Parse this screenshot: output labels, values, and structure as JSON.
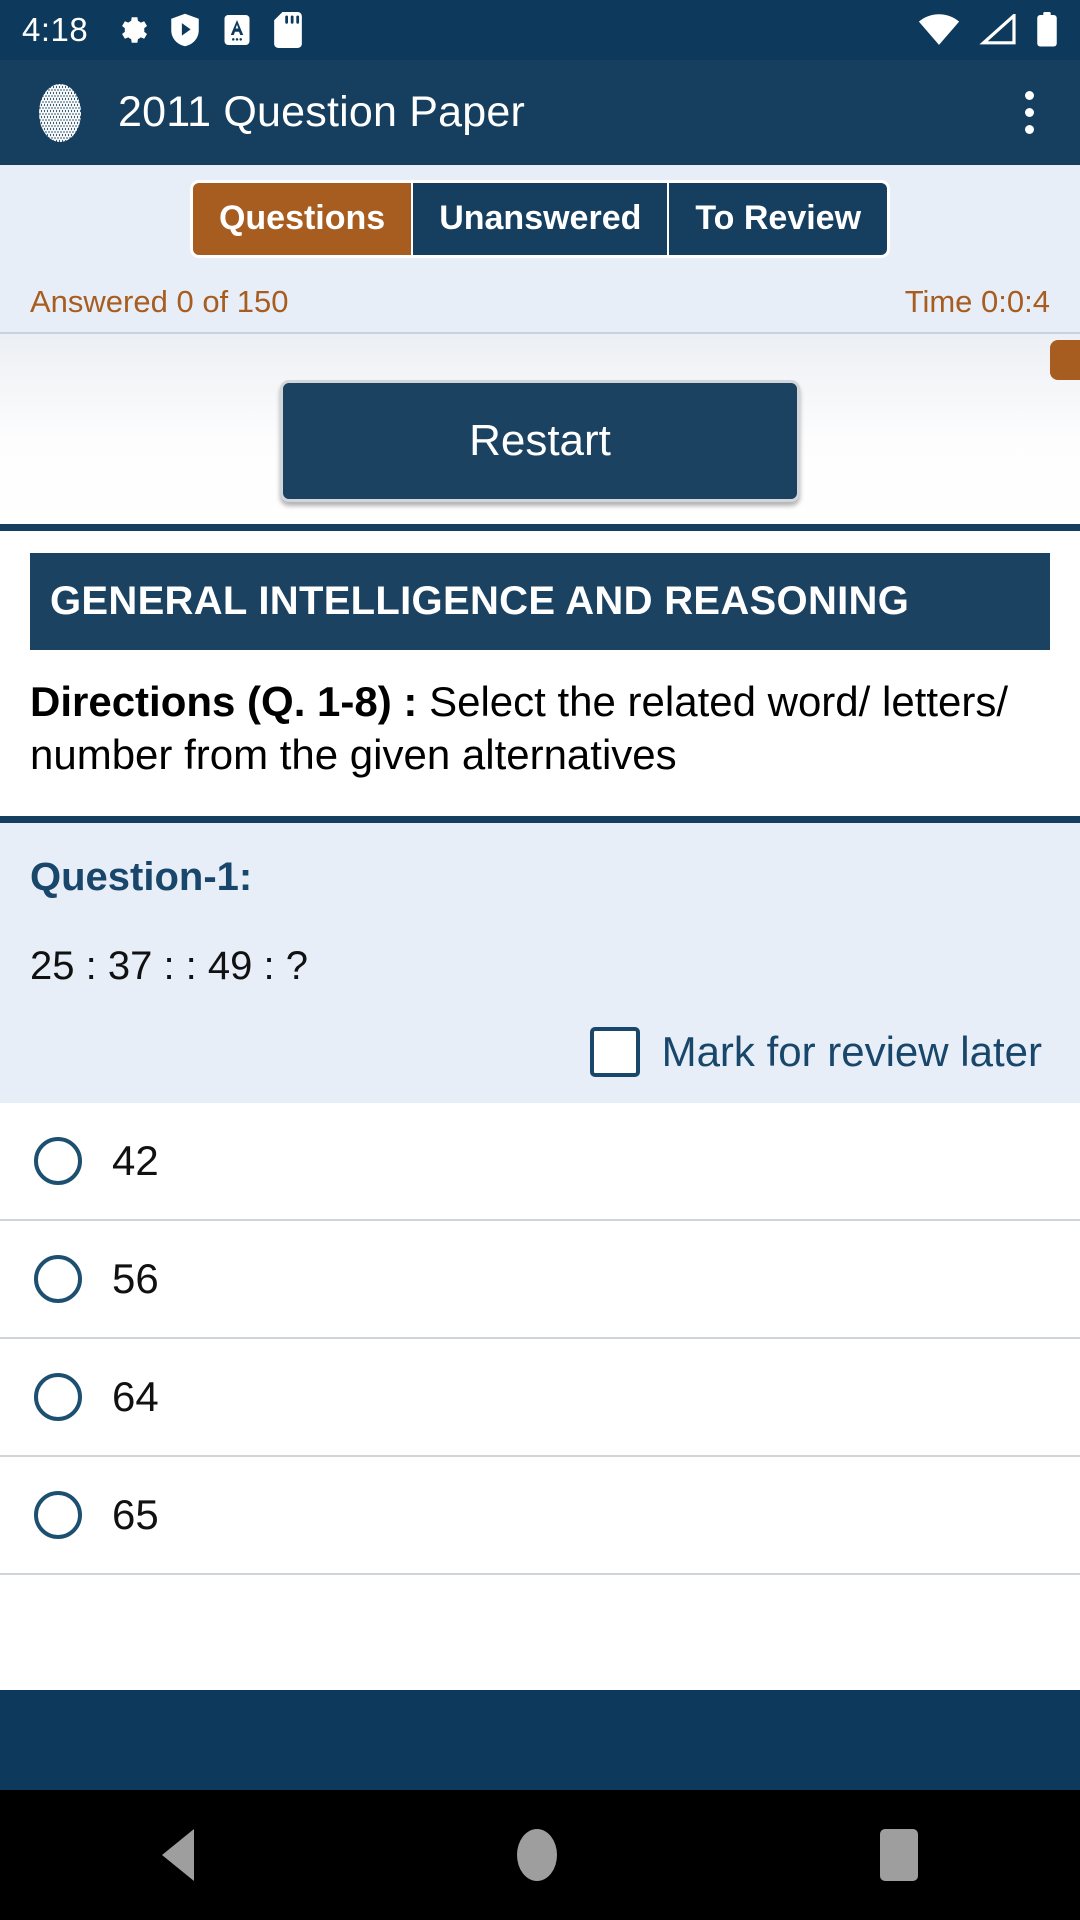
{
  "statusbar": {
    "clock": "4:18",
    "left_icons": [
      "gear-icon",
      "shield-play-icon",
      "text-a-icon",
      "sd-card-icon"
    ],
    "right_icons": [
      "wifi-icon",
      "signal-icon",
      "battery-icon"
    ]
  },
  "appbar": {
    "logo": "diamond-mesh-logo",
    "title": "2011 Question Paper",
    "overflow": "overflow-menu-icon"
  },
  "tabs": [
    {
      "label": "Questions",
      "active": true
    },
    {
      "label": "Unanswered",
      "active": false
    },
    {
      "label": "To Review",
      "active": false
    }
  ],
  "status": {
    "answered": "Answered 0 of 150",
    "time": "Time 0:0:4"
  },
  "actions": {
    "restart_label": "Restart"
  },
  "section": {
    "banner": "GENERAL INTELLIGENCE AND REASONING",
    "directions_bold": "Directions (Q. 1-8) :",
    "directions_rest": " Select the related word/ letters/ number from the given alternatives"
  },
  "question": {
    "label": "Question-1:",
    "text": "25 : 37 : : 49 : ?",
    "mark_label": "Mark for review later",
    "mark_checked": false,
    "options": [
      {
        "label": "42",
        "selected": false
      },
      {
        "label": "56",
        "selected": false
      },
      {
        "label": "64",
        "selected": false
      },
      {
        "label": "65",
        "selected": false
      }
    ]
  },
  "navbar": {
    "back": "back-triangle-icon",
    "home": "home-circle-icon",
    "recents": "recents-square-icon"
  },
  "colors": {
    "navy_dark": "#0d3a5c",
    "navy": "#163f5f",
    "orange": "#a85d20",
    "tab_bg": "#e8eef7"
  }
}
